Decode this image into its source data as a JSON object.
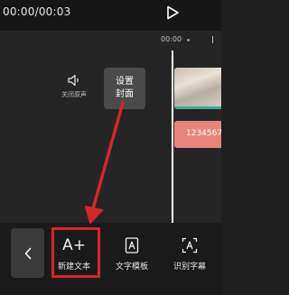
{
  "player": {
    "time": "00:00/00:03",
    "play_icon": "play-icon"
  },
  "timeline": {
    "ruler_label": "00:00",
    "mute_label": "关闭原声",
    "mute_icon": "speaker-mute-icon",
    "cover_label": "设置\n封面",
    "text_clip_label": "1234567"
  },
  "toolbar": {
    "back_icon": "chevron-left-icon",
    "tools": [
      {
        "label": "新建文本",
        "icon": "text-add-icon",
        "icon_text": "A+"
      },
      {
        "label": "文字模板",
        "icon": "text-template-icon"
      },
      {
        "label": "识别字幕",
        "icon": "subtitle-recognize-icon"
      }
    ]
  },
  "annotation": {
    "color": "#d8242a"
  },
  "colors": {
    "background": "#1e1e1e",
    "text_clip": "#e8857a",
    "cover_button": "#4a4a4a",
    "clip_accent": "#3aa89b"
  }
}
